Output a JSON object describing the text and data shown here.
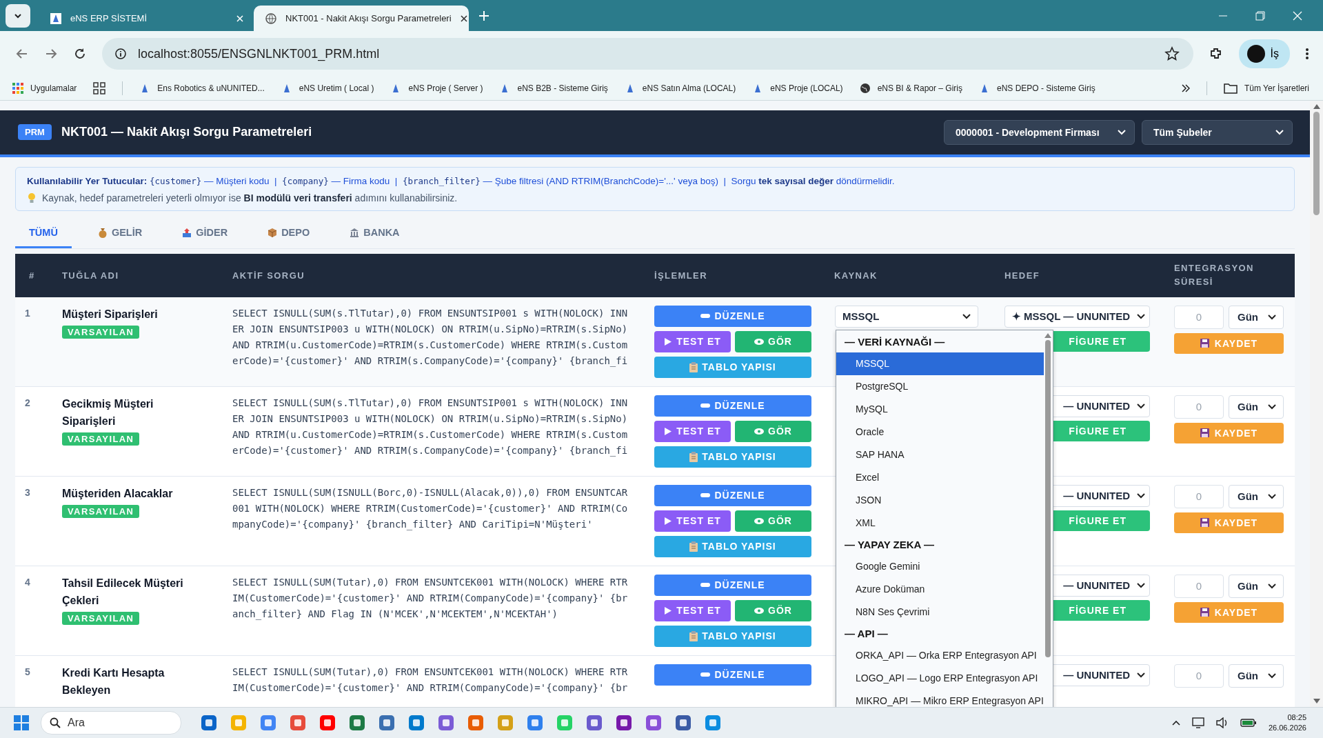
{
  "browser": {
    "tabs": [
      {
        "title": "eNS ERP SİSTEMİ",
        "kind": "logo",
        "selected": false
      },
      {
        "title": "NKT001 - Nakit Akışı Sorgu Parametreleri",
        "kind": "globe",
        "selected": true
      }
    ],
    "url": "localhost:8055/ENSGNLNKT001_PRM.html",
    "profile": "İş",
    "apps": "Uygulamalar",
    "bookmarks": [
      {
        "label": "Ens Robotics & uNUNITED...",
        "kind": "logo"
      },
      {
        "label": "eNS Uretim ( Local )",
        "kind": "logo"
      },
      {
        "label": "eNS Proje ( Server )",
        "kind": "logo"
      },
      {
        "label": "eNS B2B - Sisteme Giriş",
        "kind": "logo"
      },
      {
        "label": "eNS Satın Alma (LOCAL)",
        "kind": "logo"
      },
      {
        "label": "eNS Proje (LOCAL)",
        "kind": "logo"
      },
      {
        "label": "eNS BI & Rapor – Giriş",
        "kind": "globe"
      },
      {
        "label": "eNS DEPO - Sisteme Giriş",
        "kind": "logo"
      }
    ],
    "all_bookmarks": "Tüm Yer İşaretleri"
  },
  "header": {
    "badge": "PRM",
    "title": "NKT001 — Nakit Akışı Sorgu Parametreleri",
    "company": "0000001 - Development Firması",
    "branch": "Tüm Şubeler"
  },
  "info": {
    "line1": [
      {
        "kind": "bold",
        "text": "Kullanılabilir Yer Tutucular: "
      },
      {
        "kind": "code",
        "text": "{customer}"
      },
      {
        "kind": "text",
        "text": " — Müşteri kodu  |  "
      },
      {
        "kind": "code",
        "text": "{company}"
      },
      {
        "kind": "text",
        "text": " — Firma kodu  |  "
      },
      {
        "kind": "code",
        "text": "{branch_filter}"
      },
      {
        "kind": "text",
        "text": " — Şube filtresi (AND RTRIM(BranchCode)='...' veya boş)  |  Sorgu "
      },
      {
        "kind": "bold",
        "text": "tek sayısal değer"
      },
      {
        "kind": "text",
        "text": " döndürmelidir."
      }
    ],
    "line2": [
      {
        "kind": "text",
        "text": "Kaynak, hedef parametreleri yeterli olmıyor ise "
      },
      {
        "kind": "bold",
        "text": "BI modülü veri transferi"
      },
      {
        "kind": "text",
        "text": " adımını kullanabilirsiniz."
      }
    ]
  },
  "tabs": [
    {
      "label": "TÜMÜ",
      "kind": "all",
      "selected": true
    },
    {
      "label": "GELİR",
      "kind": "income",
      "selected": false
    },
    {
      "label": "GİDER",
      "kind": "expense",
      "selected": false
    },
    {
      "label": "DEPO",
      "kind": "stock",
      "selected": false
    },
    {
      "label": "BANKA",
      "kind": "bank",
      "selected": false
    }
  ],
  "table": {
    "columns": [
      "#",
      "TUĞLA ADI",
      "AKTİF SORGU",
      "İŞLEMLER",
      "KAYNAK",
      "HEDEF",
      "ENTEGRASYON SÜRESİ"
    ],
    "rows": [
      {
        "no": "1",
        "name": "Müşteri Siparişleri",
        "badge": "VARSAYILAN",
        "query": "SELECT ISNULL(SUM(s.TlTutar),0) FROM ENSUNTSIP001 s WITH(NOLOCK) INNER JOIN ENSUNTSIP003 u WITH(NOLOCK) ON RTRIM(u.SipNo)=RTRIM(s.SipNo) AND RTRIM(u.CustomerCode)=RTRIM(s.CustomerCode) WHERE RTRIM(s.CustomerCode)='{customer}' AND RTRIM(s.CompanyCode)='{company}' {branch_fi",
        "buttons": [
          {
            "kind": "edit",
            "label": "DÜZENLE"
          },
          {
            "kind": "test",
            "label": "TEST ET"
          },
          {
            "kind": "view",
            "label": "GÖR"
          },
          {
            "kind": "schema",
            "label": "TABLO YAPISI"
          }
        ],
        "source": "MSSQL",
        "target": "✦ MSSQL — UNUNITED",
        "configure": "FİGURE ET",
        "duration_placeholder": "0",
        "unit": "Gün",
        "save": "KAYDET"
      },
      {
        "no": "2",
        "name": "Gecikmiş Müşteri Siparişleri",
        "badge": "VARSAYILAN",
        "query": "SELECT ISNULL(SUM(s.TlTutar),0) FROM ENSUNTSIP001 s WITH(NOLOCK) INNER JOIN ENSUNTSIP003 u WITH(NOLOCK) ON RTRIM(u.SipNo)=RTRIM(s.SipNo) AND RTRIM(u.CustomerCode)=RTRIM(s.CustomerCode) WHERE RTRIM(s.CustomerCode)='{customer}' AND RTRIM(s.CompanyCode)='{company}' {branch_fi",
        "buttons": [
          {
            "kind": "edit",
            "label": "DÜZENLE"
          },
          {
            "kind": "test",
            "label": "TEST ET"
          },
          {
            "kind": "view",
            "label": "GÖR"
          },
          {
            "kind": "schema",
            "label": "TABLO YAPISI"
          }
        ],
        "target": "— UNUNITED",
        "configure": "FİGURE ET",
        "duration_placeholder": "0",
        "unit": "Gün",
        "save": "KAYDET"
      },
      {
        "no": "3",
        "name": "Müşteriden Alacaklar",
        "badge": "VARSAYILAN",
        "query": "SELECT ISNULL(SUM(ISNULL(Borc,0)-ISNULL(Alacak,0)),0) FROM ENSUNTCAR001 WITH(NOLOCK) WHERE RTRIM(CustomerCode)='{customer}' AND RTRIM(CompanyCode)='{company}' {branch_filter} AND CariTipi=N'Müşteri'",
        "buttons": [
          {
            "kind": "edit",
            "label": "DÜZENLE"
          },
          {
            "kind": "test",
            "label": "TEST ET"
          },
          {
            "kind": "view",
            "label": "GÖR"
          },
          {
            "kind": "schema",
            "label": "TABLO YAPISI"
          }
        ],
        "target": "— UNUNITED",
        "configure": "FİGURE ET",
        "duration_placeholder": "0",
        "unit": "Gün",
        "save": "KAYDET"
      },
      {
        "no": "4",
        "name": "Tahsil Edilecek Müşteri Çekleri",
        "badge": "VARSAYILAN",
        "query": "SELECT ISNULL(SUM(Tutar),0) FROM ENSUNTCEK001 WITH(NOLOCK) WHERE RTRIM(CustomerCode)='{customer}' AND RTRIM(CompanyCode)='{company}' {branch_filter} AND Flag IN (N'MCEK',N'MCEKTEM',N'MCEKTAH')",
        "buttons": [
          {
            "kind": "edit",
            "label": "DÜZENLE"
          },
          {
            "kind": "test",
            "label": "TEST ET"
          },
          {
            "kind": "view",
            "label": "GÖR"
          },
          {
            "kind": "schema",
            "label": "TABLO YAPISI"
          }
        ],
        "target": "— UNUNITED",
        "configure": "FİGURE ET",
        "duration_placeholder": "0",
        "unit": "Gün",
        "save": "KAYDET"
      },
      {
        "no": "5",
        "name": "Kredi Kartı Hesapta Bekleyen",
        "query": "SELECT ISNULL(SUM(Tutar),0) FROM ENSUNTCEK001 WITH(NOLOCK) WHERE RTRIM(CustomerCode)='{customer}' AND RTRIM(CompanyCode)='{company}' {br",
        "buttons": [
          {
            "kind": "edit",
            "label": "DÜZENLE"
          }
        ],
        "target": "— UNUNITED",
        "duration_placeholder": "0",
        "unit": "Gün"
      }
    ]
  },
  "dropdown": {
    "groups": [
      {
        "label": "— VERİ KAYNAĞI —",
        "options": [
          {
            "label": "MSSQL",
            "selected": true
          },
          {
            "label": "PostgreSQL",
            "selected": false
          },
          {
            "label": "MySQL",
            "selected": false
          },
          {
            "label": "Oracle",
            "selected": false
          },
          {
            "label": "SAP HANA",
            "selected": false
          },
          {
            "label": "Excel",
            "selected": false
          },
          {
            "label": "JSON",
            "selected": false
          },
          {
            "label": "XML",
            "selected": false
          }
        ]
      },
      {
        "label": "— YAPAY ZEKA —",
        "options": [
          {
            "label": "Google Gemini",
            "selected": false
          },
          {
            "label": "Azure Doküman",
            "selected": false
          },
          {
            "label": "N8N Ses Çevrimi",
            "selected": false
          }
        ]
      },
      {
        "label": "— API —",
        "options": [
          {
            "label": "ORKA_API — Orka ERP Entegrasyon API",
            "selected": false
          },
          {
            "label": "LOGO_API — Logo ERP Entegrasyon API",
            "selected": false
          },
          {
            "label": "MIKRO_API — Mikro ERP Entegrasyon API",
            "selected": false
          }
        ]
      }
    ]
  },
  "taskbar": {
    "search": "Ara",
    "time": "08:25",
    "date": "26.06.2026"
  }
}
